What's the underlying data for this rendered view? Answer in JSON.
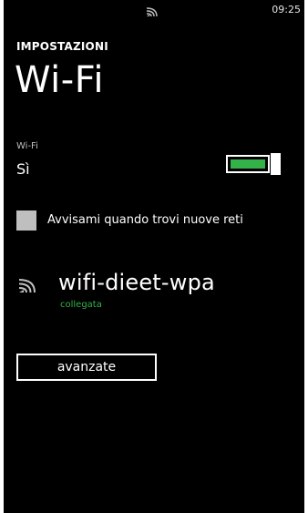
{
  "status_bar": {
    "signal_icon": "wifi-signal-icon",
    "time": "09:25"
  },
  "header": {
    "app_title": "IMPOSTAZIONI",
    "page_title": "Wi-Fi"
  },
  "wifi_toggle": {
    "label": "Wi-Fi",
    "state": "Sì",
    "is_on": true,
    "color": "#33b24a"
  },
  "notify": {
    "label": "Avvisami quando trovi nuove reti",
    "checked": false
  },
  "network": {
    "icon": "wifi-signal-icon",
    "name": "wifi-dieet-wpa",
    "status": "collegata",
    "status_color": "#33b24a"
  },
  "actions": {
    "advanced_label": "avanzate"
  }
}
